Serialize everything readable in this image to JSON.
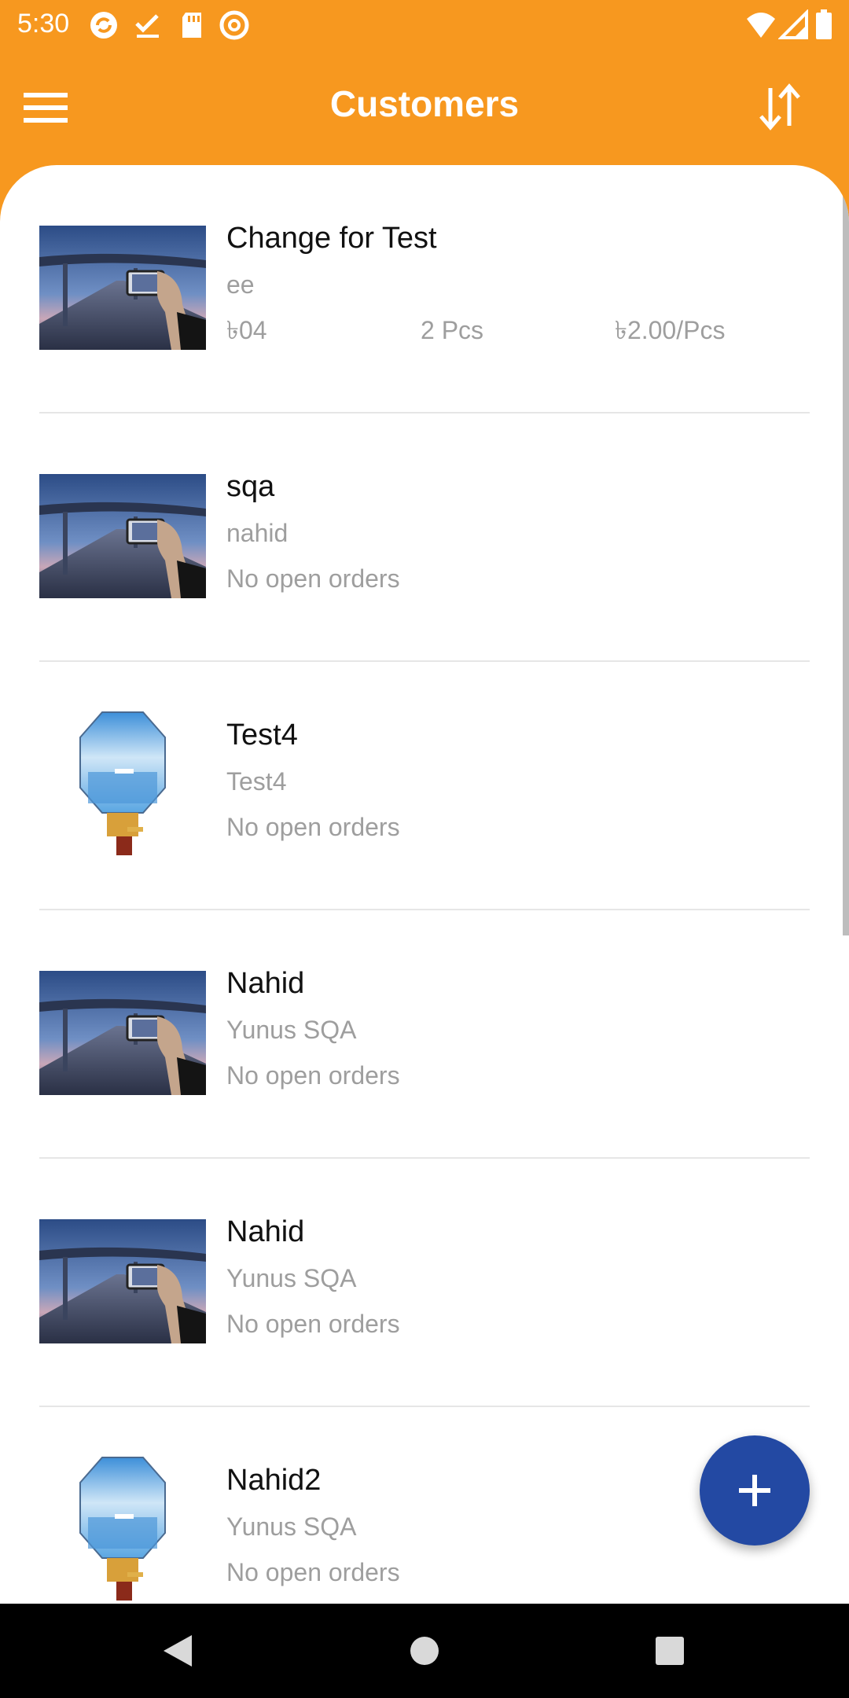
{
  "status_bar": {
    "time": "5:30",
    "icons": [
      "sync-icon",
      "check-icon",
      "sd-card-icon",
      "at-icon",
      "wifi-icon",
      "signal-icon",
      "battery-icon"
    ]
  },
  "app_bar": {
    "title": "Customers",
    "menu_icon": "hamburger-menu-icon",
    "sort_icon": "sort-icon",
    "background_color": "#F7981F"
  },
  "customers": [
    {
      "name": "Change for Test",
      "subtitle": "ee",
      "thumbnail": "bridge-photo",
      "order_amount": "৳04",
      "order_qty": "2 Pcs",
      "order_rate": "৳2.00/Pcs"
    },
    {
      "name": "sqa",
      "subtitle": "nahid",
      "thumbnail": "bridge-photo",
      "status": "No open orders"
    },
    {
      "name": "Test4",
      "subtitle": "Test4",
      "thumbnail": "octagon-display-photo",
      "status": "No open orders"
    },
    {
      "name": "Nahid",
      "subtitle": "Yunus SQA",
      "thumbnail": "bridge-photo",
      "status": "No open orders"
    },
    {
      "name": "Nahid",
      "subtitle": "Yunus SQA",
      "thumbnail": "bridge-photo",
      "status": "No open orders"
    },
    {
      "name": "Nahid2",
      "subtitle": "Yunus SQA",
      "thumbnail": "octagon-display-photo",
      "status": "No open orders"
    }
  ],
  "fab": {
    "icon": "plus-icon",
    "color": "#2349A3"
  },
  "nav_bar": {
    "icons": [
      "back-icon",
      "home-icon",
      "recents-icon"
    ]
  }
}
